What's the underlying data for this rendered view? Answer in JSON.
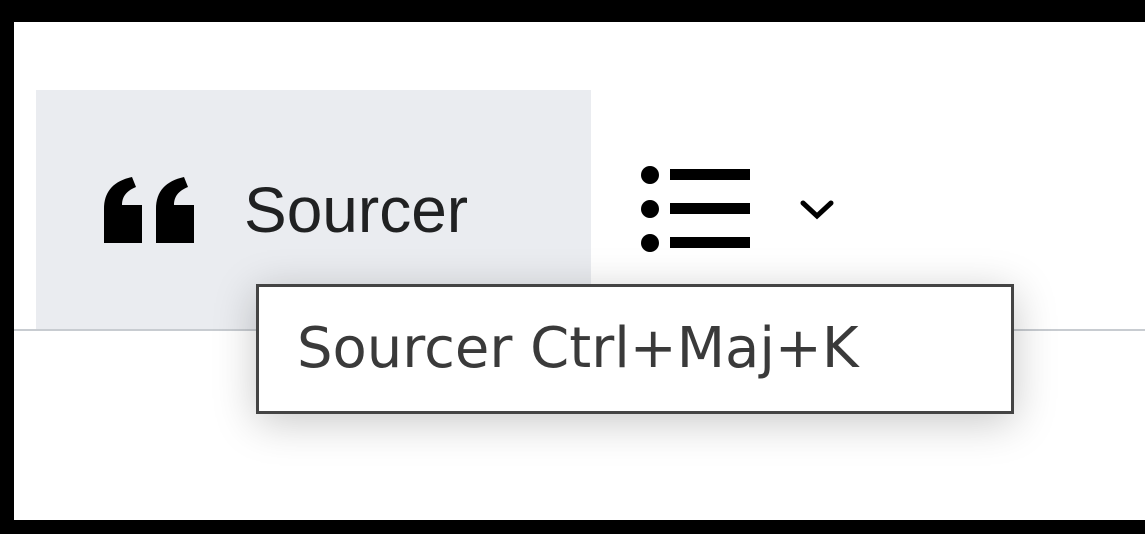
{
  "toolbar": {
    "cite_button": {
      "label": "Sourcer",
      "icon": "quote-icon"
    },
    "list_button": {
      "icon": "bullet-list-icon",
      "dropdown_icon": "chevron-down-icon"
    }
  },
  "tooltip": {
    "text": "Sourcer Ctrl+Maj+K"
  },
  "colors": {
    "active_button_bg": "#eaecf0",
    "text": "#202122",
    "divider": "#c8ccd1",
    "tooltip_border": "#444444"
  }
}
